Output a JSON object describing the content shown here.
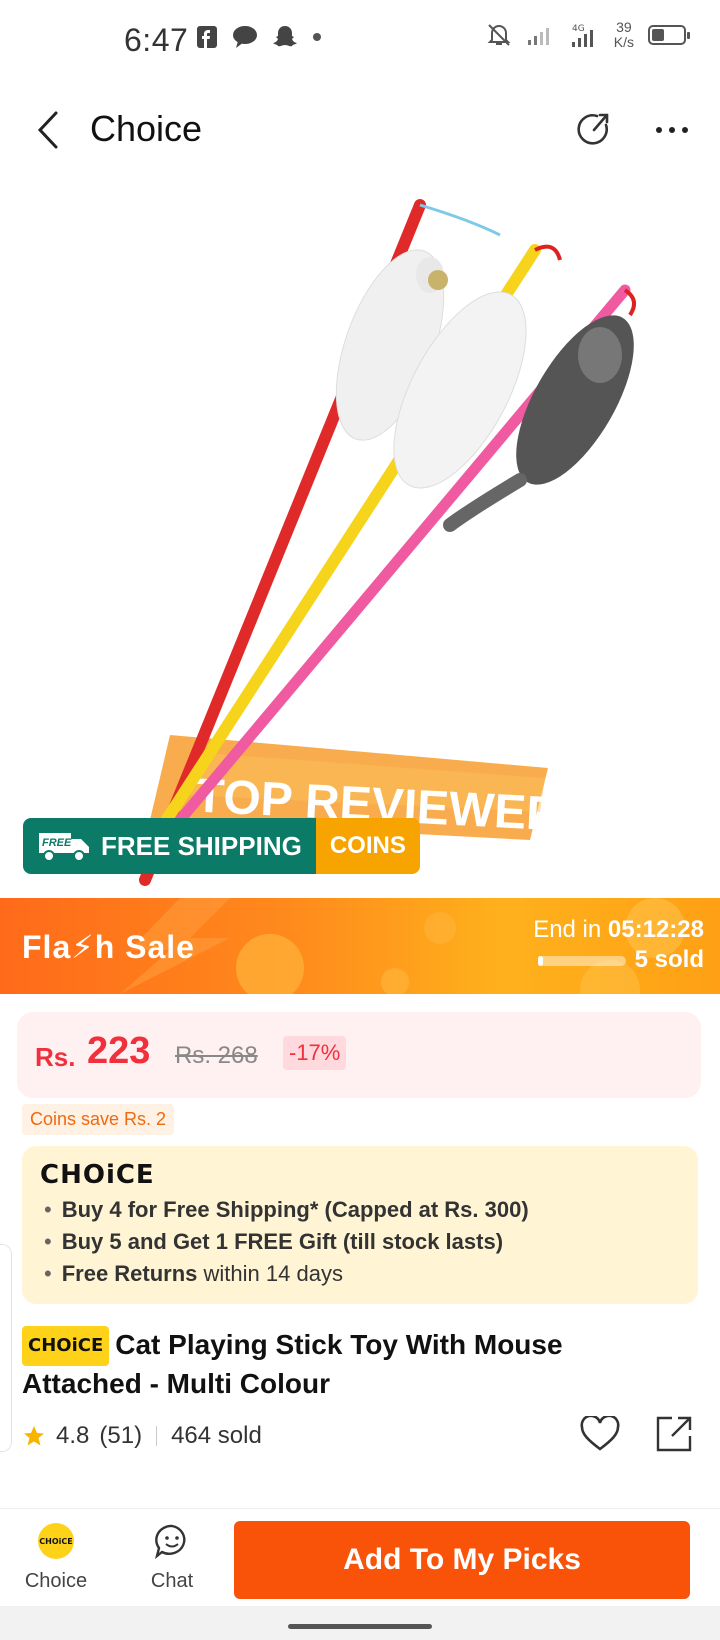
{
  "status_bar": {
    "time": "6:47",
    "net_speed_value": "39",
    "net_speed_unit": "K/s",
    "network": "4G"
  },
  "header": {
    "title": "Choice"
  },
  "badges": {
    "free_shipping_tag": "FREE",
    "free_shipping": "FREE SHIPPING",
    "coins": "COINS",
    "image_ribbon": "TOP REVIEWED"
  },
  "flash_sale": {
    "title": "Fla⚡h  Sale",
    "end_label": "End in",
    "countdown": "05:12:28",
    "sold": "5 sold",
    "progress_fraction": 0.06
  },
  "price": {
    "currency": "Rs.",
    "current": "223",
    "original": "Rs. 268",
    "discount": "-17%"
  },
  "coins_save": "Coins save Rs. 2",
  "choice_box": {
    "logo": "CHOiCE",
    "items": [
      {
        "bold": "Buy 4 for  Free Shipping* (Capped at Rs. 300)",
        "rest": ""
      },
      {
        "bold": "Buy 5 and Get 1 FREE Gift (till stock lasts)",
        "rest": ""
      },
      {
        "bold": "Free Returns",
        "rest": " within 14 days"
      }
    ]
  },
  "product": {
    "choice_tag": "CHOiCE",
    "title": "Cat Playing Stick Toy With Mouse Attached - Multi Colour",
    "rating": "4.8",
    "reviews": "(51)",
    "sold": "464 sold"
  },
  "bottom_bar": {
    "choice_label": "Choice",
    "choice_icon_text": "CHOiCE",
    "chat_label": "Chat",
    "add_button": "Add To My Picks"
  },
  "colors": {
    "accent_orange": "#f9530a",
    "price_red": "#f0303c",
    "shipping_green": "#0b7a66",
    "coins_yellow": "#f7a400",
    "choice_yellow": "#ffd21a"
  }
}
